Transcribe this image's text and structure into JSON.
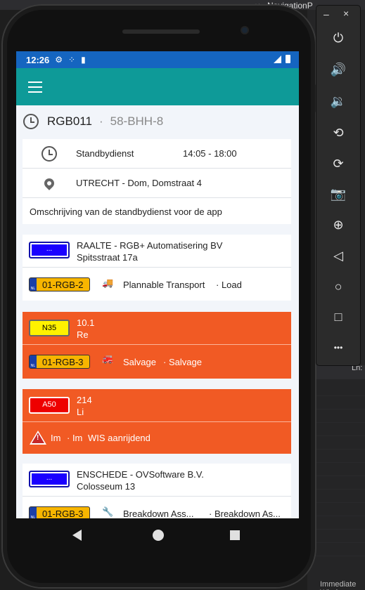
{
  "ide": {
    "tab_label": "NavigationP",
    "tab_small": "✕",
    "ln_label": "Ln:",
    "immediate_label": "Immediate Window"
  },
  "statusbar": {
    "time": "12:26",
    "icons": [
      "gear-icon",
      "network-dots-icon",
      "sd-card-icon",
      "signal-icon",
      "battery-icon"
    ]
  },
  "appbar": {
    "menu_icon": "hamburger-menu-icon",
    "color": "#0e9a98"
  },
  "header": {
    "vehicle_code": "RGB011",
    "separator": "·",
    "plate": "58-BHH-8"
  },
  "service_card": {
    "service": "Standbydienst",
    "time_range": "14:05 - 18:00",
    "location": "UTRECHT - Dom, Domstraat 4",
    "description": "Omschrijving van de standbydienst voor de app"
  },
  "units": [
    {
      "plate_code": "...",
      "plate_style": "blue",
      "line1": "RAALTE - RGB+ Automatisering BV",
      "line2": "Spitsstraat 17a",
      "reg": "01-RGB-2",
      "type": "Plannable Transport",
      "load": "· Load",
      "highlight": false
    },
    {
      "plate_code": "N35",
      "plate_style": "yellow",
      "line1": "10.1",
      "line2": "Re",
      "reg": "01-RGB-3",
      "type": "Salvage",
      "load": "· Salvage",
      "highlight": true
    },
    {
      "plate_code": "A50",
      "plate_style": "red",
      "line1": "214",
      "line2": "Li",
      "status_a": "Im",
      "status_b": "· Im",
      "status_c": "WIS aanrijdend",
      "highlight": true
    },
    {
      "plate_code": "...",
      "plate_style": "blue",
      "line1": "ENSCHEDE - OVSoftware B.V.",
      "line2": "Colosseum 13",
      "reg": "01-RGB-3",
      "type": "Breakdown Ass...",
      "load": "· Breakdown As...",
      "highlight": false
    }
  ],
  "colors": {
    "status_bar": "#1565c0",
    "accent": "#f15a24",
    "appbar": "#0e9a98"
  },
  "emulator_toolbar": {
    "buttons": [
      "power-icon",
      "volume-up-icon",
      "volume-down-icon",
      "rotate-left-icon",
      "rotate-right-icon",
      "camera-icon",
      "zoom-icon",
      "back-icon",
      "home-icon",
      "overview-icon",
      "more-icon"
    ],
    "min_label": "–",
    "close_label": "×",
    "more_label": "•••"
  }
}
